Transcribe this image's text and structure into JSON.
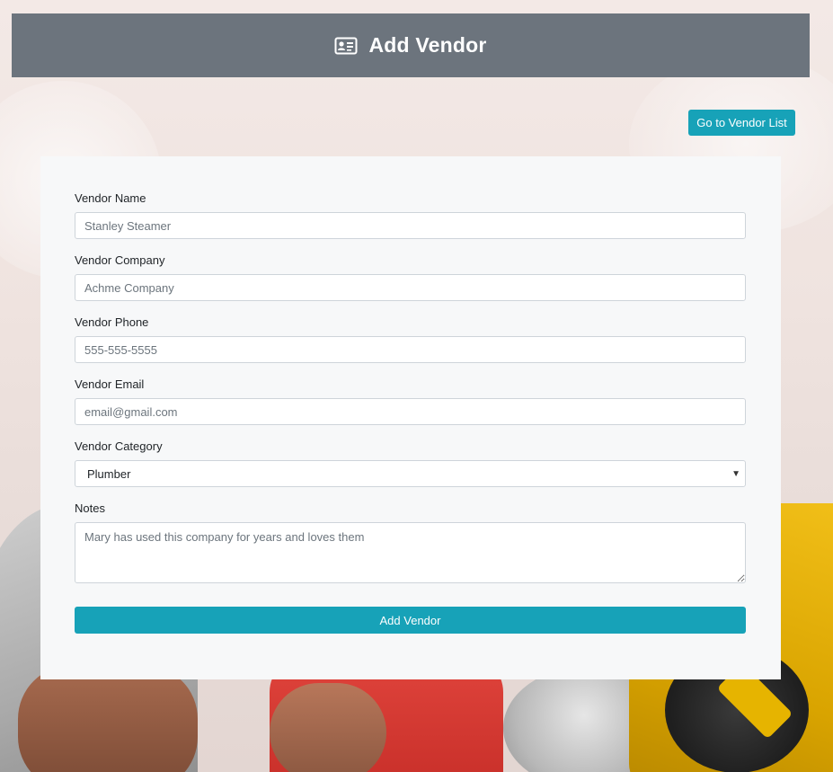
{
  "header": {
    "title": "Add Vendor",
    "icon": "address-card-icon"
  },
  "nav": {
    "vendor_list_label": "Go to Vendor List"
  },
  "form": {
    "vendor_name": {
      "label": "Vendor Name",
      "placeholder": "Stanley Steamer"
    },
    "vendor_company": {
      "label": "Vendor Company",
      "placeholder": "Achme Company"
    },
    "vendor_phone": {
      "label": "Vendor Phone",
      "placeholder": "555-555-5555"
    },
    "vendor_email": {
      "label": "Vendor Email",
      "placeholder": "email@gmail.com"
    },
    "vendor_category": {
      "label": "Vendor Category",
      "selected": "Plumber"
    },
    "notes": {
      "label": "Notes",
      "placeholder": "Mary has used this company for years and loves them"
    },
    "submit_label": "Add Vendor"
  },
  "colors": {
    "header_bg": "#6c747d",
    "accent": "#17a2b8",
    "card_bg": "#f7f8f9"
  }
}
